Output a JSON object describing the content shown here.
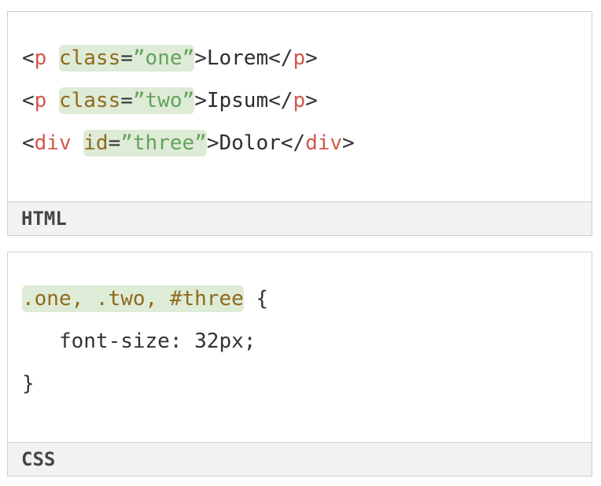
{
  "html_panel": {
    "label": "HTML",
    "lines": [
      {
        "open_lt": "<",
        "tag": "p",
        "space": " ",
        "attr": "class",
        "eq": "=",
        "value": "”one”",
        "gt": ">",
        "content": "Lorem",
        "close_lt": "</",
        "close_tag": "p",
        "close_gt": ">"
      },
      {
        "open_lt": "<",
        "tag": "p",
        "space": " ",
        "attr": "class",
        "eq": "=",
        "value": "”two”",
        "gt": ">",
        "content": "Ipsum",
        "close_lt": "</",
        "close_tag": "p",
        "close_gt": ">"
      },
      {
        "open_lt": "<",
        "tag": "div",
        "space": " ",
        "attr": "id",
        "eq": "=",
        "value": "”three”",
        "gt": ">",
        "content": "Dolor",
        "close_lt": "</",
        "close_tag": "div",
        "close_gt": ">"
      }
    ]
  },
  "css_panel": {
    "label": "CSS",
    "selector": ".one, .two, #three",
    "open_brace": " {",
    "declaration": "   font-size: 32px;",
    "close_brace": "}"
  },
  "colors": {
    "tag": "#d2584b",
    "attribute": "#8f6a1c",
    "value": "#63a35c",
    "highlight": "#deebd7",
    "footer_background": "#f2f2f2",
    "border": "#cfcfcf"
  }
}
